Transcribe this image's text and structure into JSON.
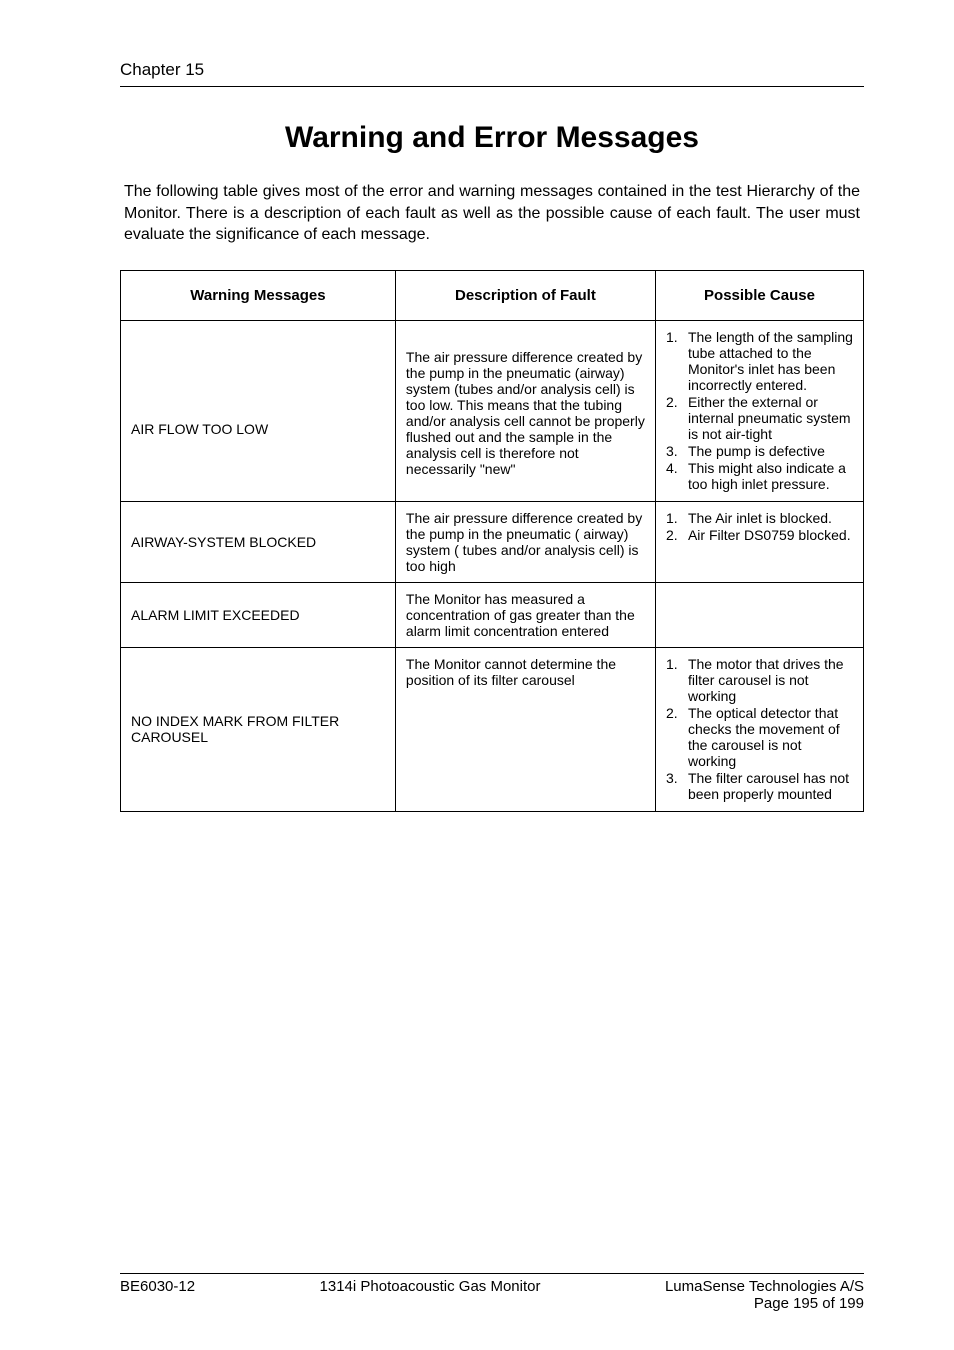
{
  "chapter": "Chapter 15",
  "title": "Warning and Error Messages",
  "intro": "The following table gives most of the error and warning messages contained in the test Hierarchy of the Monitor. There is a description of each fault as well as the possible cause of each fault. The user must evaluate the significance of each message.",
  "headers": {
    "c1": "Warning Messages",
    "c2": "Description of Fault",
    "c3": "Possible Cause"
  },
  "rows": [
    {
      "msg": "AIR FLOW TOO LOW",
      "desc": "The air pressure difference created by the pump in the pneumatic (airway) system (tubes and/or analysis cell) is too low. This means that the tubing and/or analysis cell cannot be properly flushed out and the sample in the analysis cell is therefore not necessarily \"new\"",
      "causes": [
        "The length of the sampling tube attached to the Monitor's inlet has been incorrectly entered.",
        "Either the external or internal pneumatic system is not air-tight",
        "The pump is defective",
        "This might also indicate a too high inlet pressure."
      ]
    },
    {
      "msg": "AIRWAY-SYSTEM BLOCKED",
      "desc": "The air pressure difference created by the pump in the pneumatic ( airway) system ( tubes and/or analysis cell) is too high",
      "causes": [
        "The Air inlet is blocked.",
        "Air Filter DS0759 blocked."
      ]
    },
    {
      "msg": "ALARM LIMIT EXCEEDED",
      "desc": "The Monitor has measured a concentration of gas greater than the alarm limit concentration entered",
      "causes": []
    },
    {
      "msg": "NO INDEX MARK FROM FILTER CAROUSEL",
      "desc": "The Monitor cannot determine the position of its filter carousel",
      "causes": [
        "The motor that drives the filter carousel is not working",
        "The optical detector that checks the movement of the carousel is not working",
        "The filter carousel has not been properly mounted"
      ]
    }
  ],
  "footer": {
    "left": "BE6030-12",
    "center": "1314i Photoacoustic Gas Monitor",
    "right1": "LumaSense Technologies A/S",
    "right2": "Page 195 of 199"
  }
}
